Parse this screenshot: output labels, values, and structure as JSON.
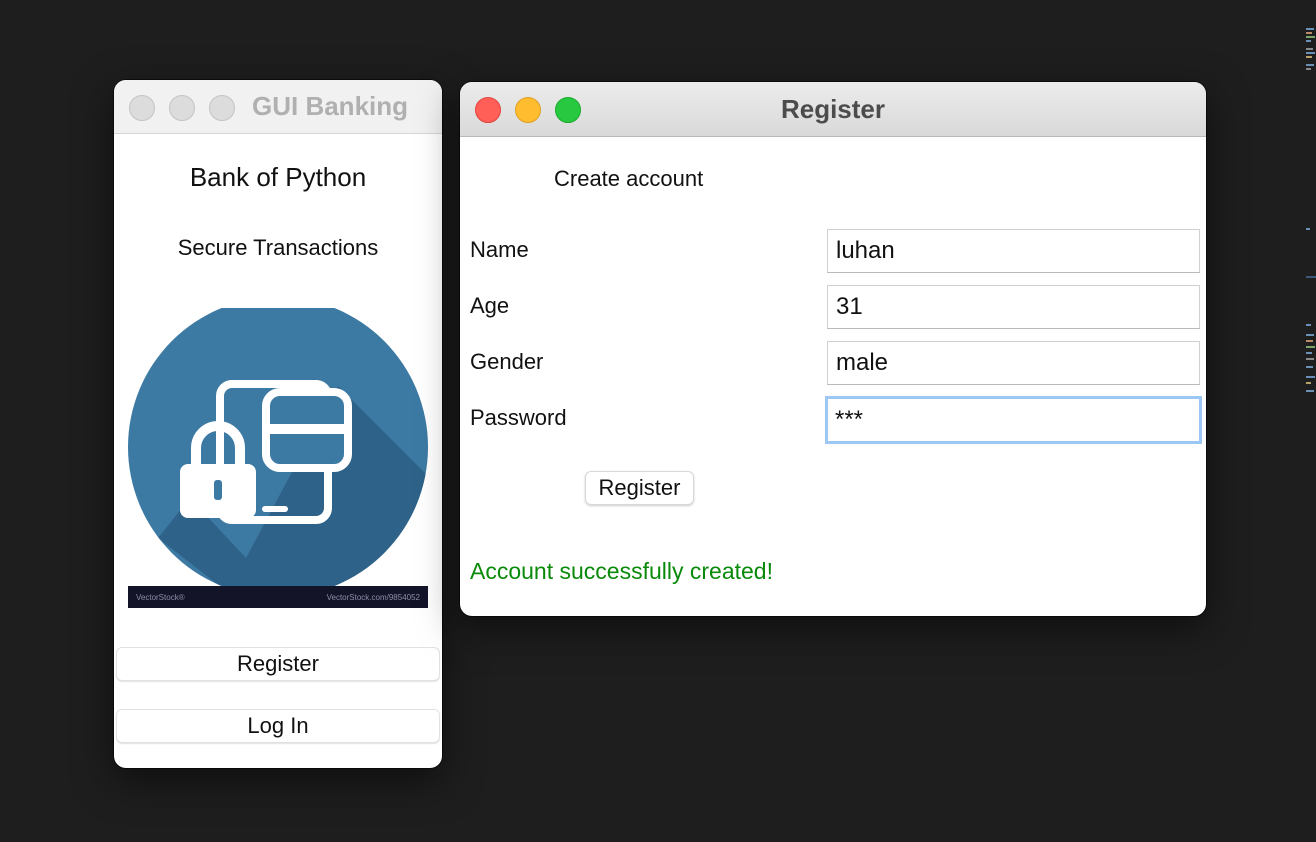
{
  "main_window": {
    "title": "GUI Banking",
    "heading": "Bank of Python",
    "subheading": "Secure Transactions",
    "logo": {
      "icon": "secure-payment-lock-card-icon",
      "footer_left": "VectorStock®",
      "footer_right": "VectorStock.com/9854052"
    },
    "buttons": {
      "register_label": "Register",
      "login_label": "Log In"
    }
  },
  "register_window": {
    "title": "Register",
    "heading": "Create account",
    "fields": {
      "name_label": "Name",
      "name_value": "luhan",
      "age_label": "Age",
      "age_value": "31",
      "gender_label": "Gender",
      "gender_value": "male",
      "password_label": "Password",
      "password_value": "***"
    },
    "submit_label": "Register",
    "status_message": "Account successfully created!"
  },
  "colors": {
    "desktop": "#1e1e1e",
    "logo_circle": "#3c7aa4",
    "success": "#0a8a0a",
    "focus_ring": "#9cc6f4",
    "close": "#ff5f57",
    "minimize": "#febc2e",
    "zoom": "#28c840"
  }
}
